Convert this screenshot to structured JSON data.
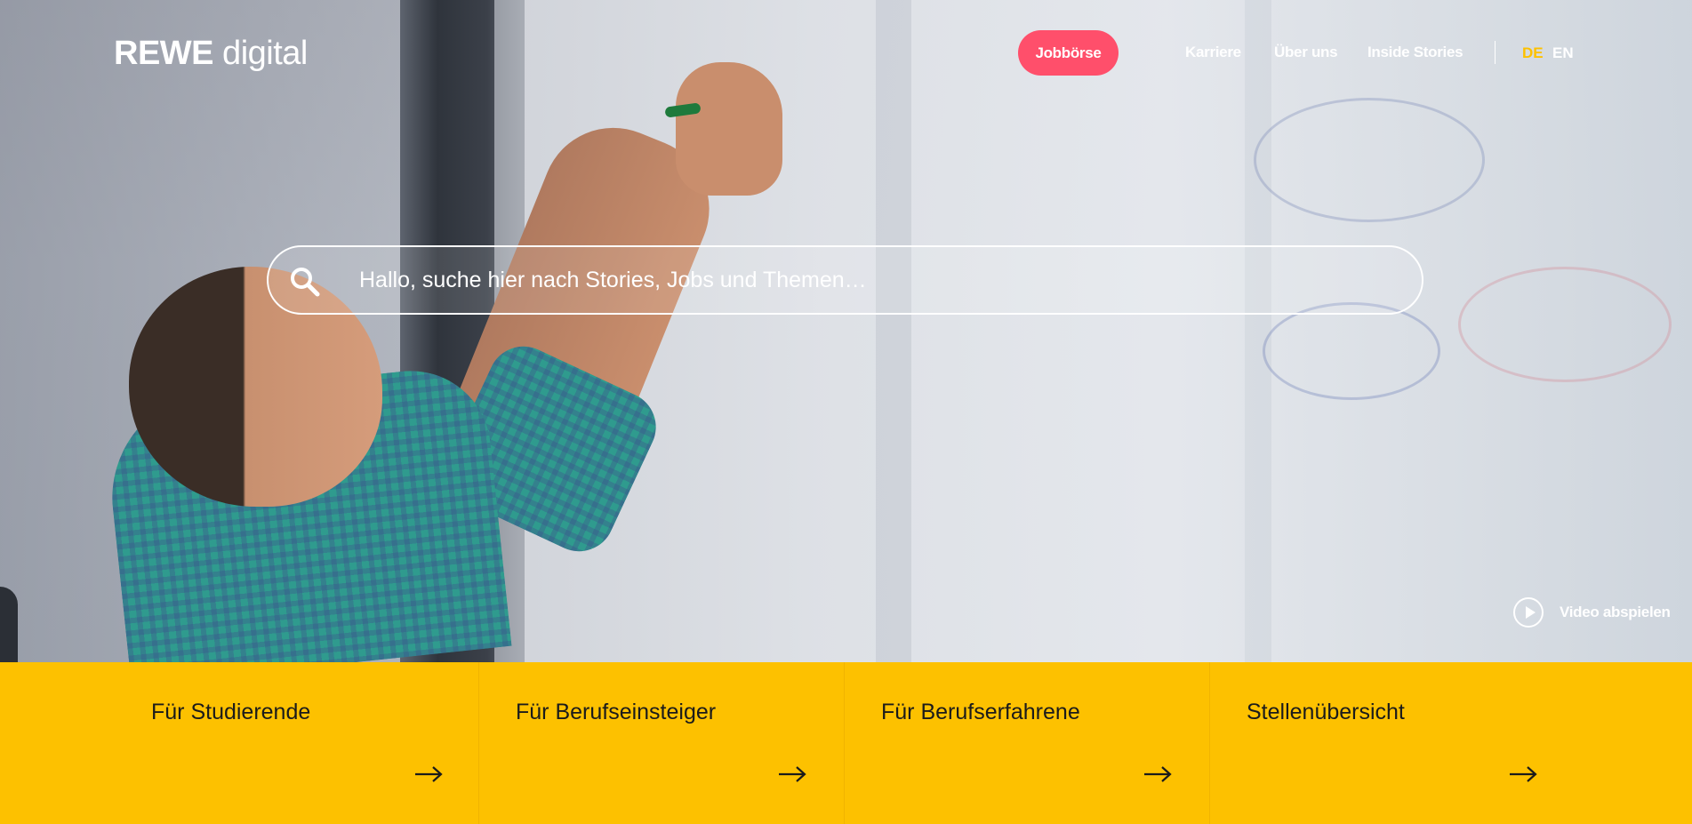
{
  "header": {
    "logo_brand": "REWE",
    "logo_suffix": " digital",
    "cta_label": "Jobbörse",
    "nav_links": [
      "Karriere",
      "Über uns",
      "Inside Stories"
    ],
    "languages": [
      {
        "code": "DE",
        "active": true
      },
      {
        "code": "EN",
        "active": false
      }
    ]
  },
  "search": {
    "placeholder": "Hallo, suche hier nach Stories, Jobs und Themen…"
  },
  "video": {
    "label": "Video abspielen"
  },
  "cards": [
    {
      "title": "Für Studierende"
    },
    {
      "title": "Für Berufseinsteiger"
    },
    {
      "title": "Für Berufserfahrene"
    },
    {
      "title": "Stellenübersicht"
    }
  ],
  "colors": {
    "accent_yellow": "#fdc100",
    "cta_pink": "#ff4f6b",
    "active_lang": "#fdc100",
    "text_white": "#ffffff",
    "card_text": "#1b1b1b"
  },
  "icons": {
    "search": "search-icon",
    "play": "play-icon",
    "arrow": "arrow-right-icon"
  }
}
